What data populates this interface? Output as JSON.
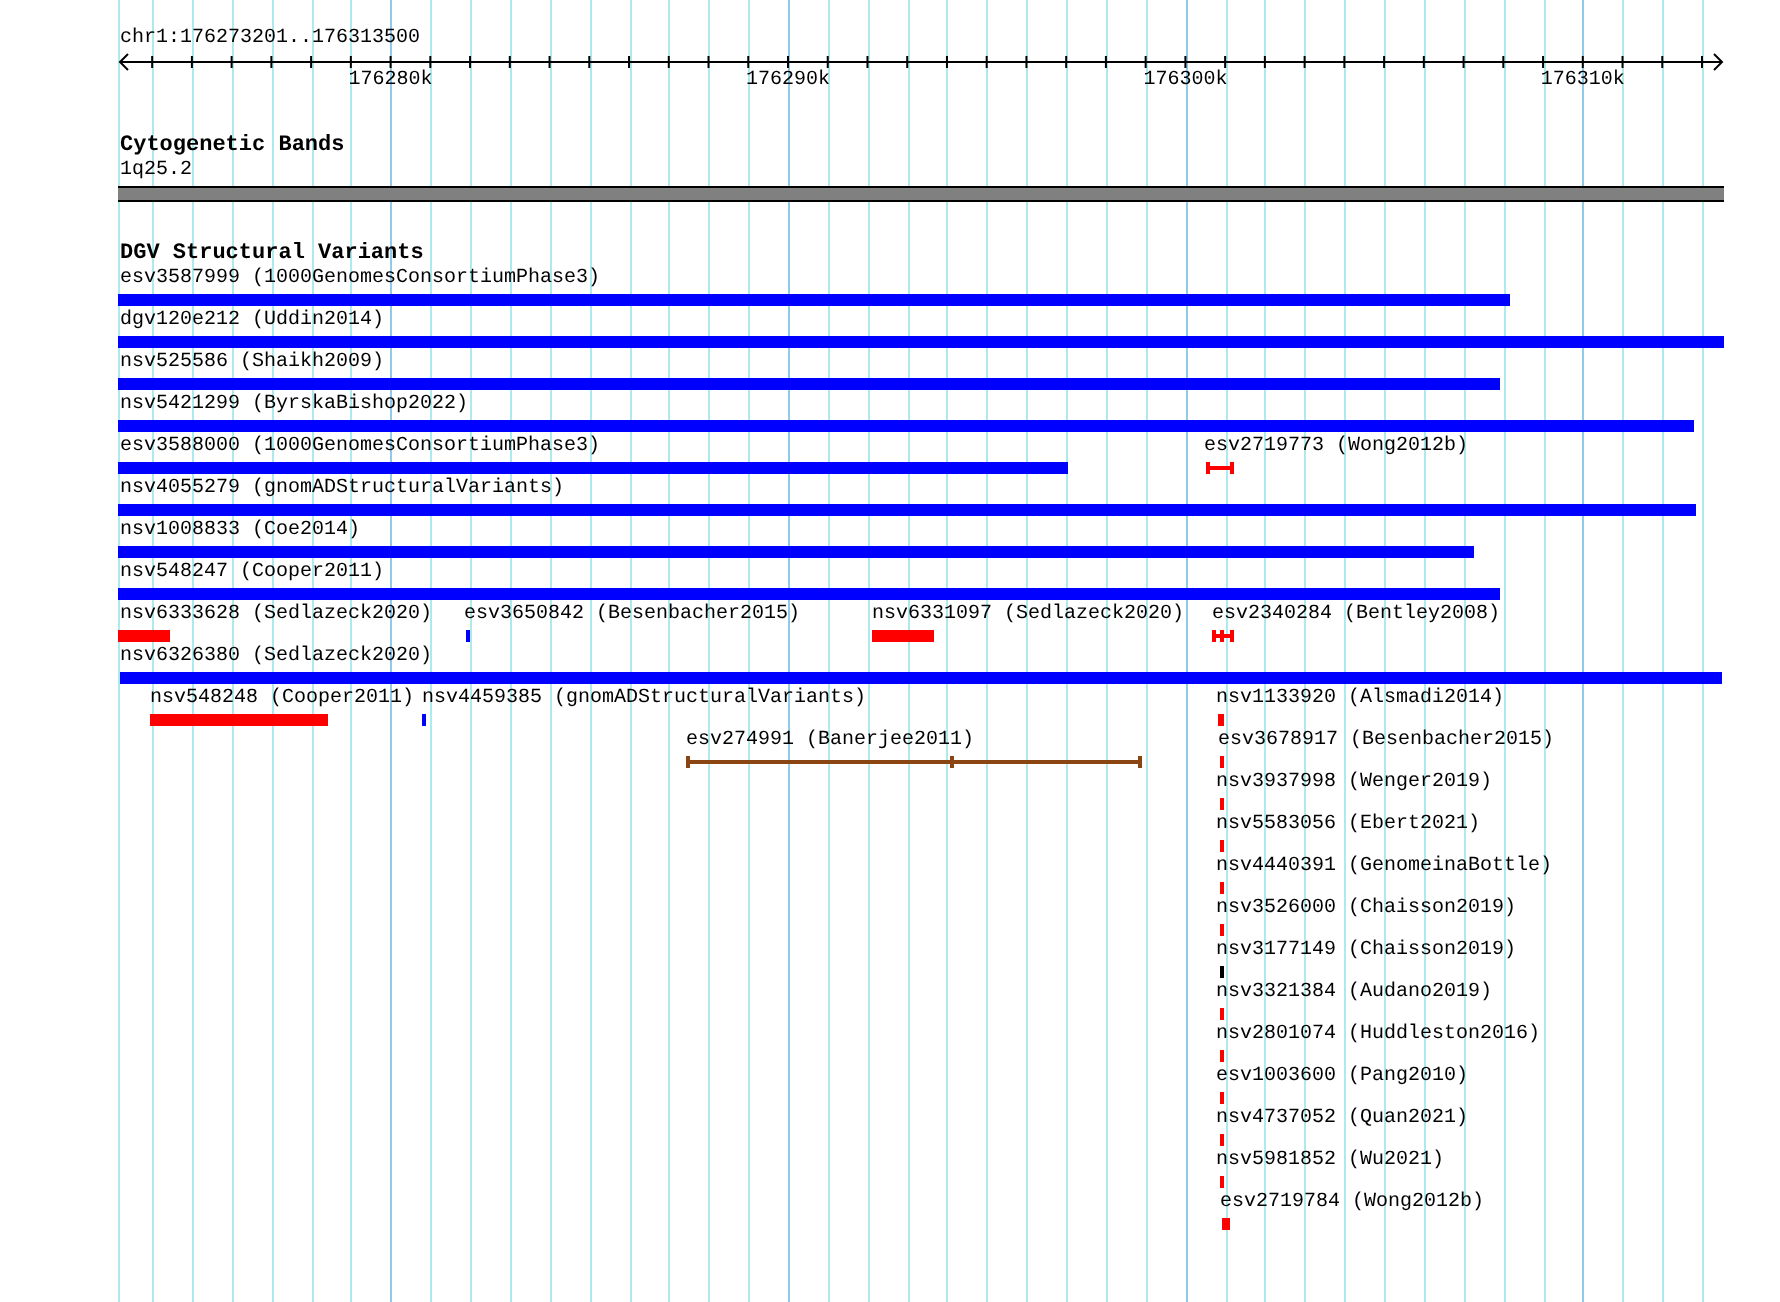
{
  "ruler": {
    "location": "chr1:176273201..176313500",
    "ticks": [
      "176280k",
      "176290k",
      "176300k",
      "176310k"
    ]
  },
  "tracks": [
    {
      "title": "Cytogenetic Bands",
      "features": [
        {
          "label": "1q25.2",
          "kind": "band",
          "color": "#808080"
        }
      ]
    },
    {
      "title": "DGV Structural Variants",
      "features": [
        {
          "label": "esv3587999 (1000GenomesConsortiumPhase3)",
          "kind": "box",
          "color": "#0000ff"
        },
        {
          "label": "dgv120e212 (Uddin2014)",
          "kind": "box",
          "color": "#0000ff"
        },
        {
          "label": "nsv525586 (Shaikh2009)",
          "kind": "box",
          "color": "#0000ff"
        },
        {
          "label": "nsv5421299 (ByrskaBishop2022)",
          "kind": "box",
          "color": "#0000ff"
        },
        {
          "label": "esv3588000 (1000GenomesConsortiumPhase3)",
          "kind": "box",
          "color": "#0000ff"
        },
        {
          "label": "esv2719773 (Wong2012b)",
          "kind": "capped",
          "color": "#ff0000"
        },
        {
          "label": "nsv4055279 (gnomADStructuralVariants)",
          "kind": "box",
          "color": "#0000ff"
        },
        {
          "label": "nsv1008833 (Coe2014)",
          "kind": "box",
          "color": "#0000ff"
        },
        {
          "label": "nsv548247 (Cooper2011)",
          "kind": "box",
          "color": "#0000ff"
        },
        {
          "label": "nsv6333628 (Sedlazeck2020)",
          "kind": "box",
          "color": "#ff0000"
        },
        {
          "label": "esv3650842 (Besenbacher2015)",
          "kind": "box",
          "color": "#0000ff"
        },
        {
          "label": "nsv6331097 (Sedlazeck2020)",
          "kind": "box",
          "color": "#ff0000"
        },
        {
          "label": "esv2340284 (Bentley2008)",
          "kind": "split",
          "color": "#ff0000"
        },
        {
          "label": "nsv6326380 (Sedlazeck2020)",
          "kind": "box",
          "color": "#0000ff"
        },
        {
          "label": "nsv548248 (Cooper2011)",
          "kind": "box",
          "color": "#ff0000"
        },
        {
          "label": "nsv4459385 (gnomADStructuralVariants)",
          "kind": "box",
          "color": "#0000ff"
        },
        {
          "label": "nsv1133920 (Alsmadi2014)",
          "kind": "box",
          "color": "#ff0000"
        },
        {
          "label": "esv274991 (Banerjee2011)",
          "kind": "split",
          "color": "#8b4513"
        },
        {
          "label": "esv3678917 (Besenbacher2015)",
          "kind": "box",
          "color": "#ff0000"
        },
        {
          "label": "nsv3937998 (Wenger2019)",
          "kind": "box",
          "color": "#ff0000"
        },
        {
          "label": "nsv5583056 (Ebert2021)",
          "kind": "box",
          "color": "#ff0000"
        },
        {
          "label": "nsv4440391 (GenomeinaBottle)",
          "kind": "box",
          "color": "#ff0000"
        },
        {
          "label": "nsv3526000 (Chaisson2019)",
          "kind": "box",
          "color": "#ff0000"
        },
        {
          "label": "nsv3177149 (Chaisson2019)",
          "kind": "box",
          "color": "#000000"
        },
        {
          "label": "nsv3321384 (Audano2019)",
          "kind": "box",
          "color": "#ff0000"
        },
        {
          "label": "nsv2801074 (Huddleston2016)",
          "kind": "box",
          "color": "#ff0000"
        },
        {
          "label": "esv1003600 (Pang2010)",
          "kind": "box",
          "color": "#ff0000"
        },
        {
          "label": "nsv4737052 (Quan2021)",
          "kind": "box",
          "color": "#ff0000"
        },
        {
          "label": "nsv5981852 (Wu2021)",
          "kind": "box",
          "color": "#ff0000"
        },
        {
          "label": "esv2719784 (Wong2012b)",
          "kind": "box",
          "color": "#ff0000"
        }
      ]
    }
  ]
}
